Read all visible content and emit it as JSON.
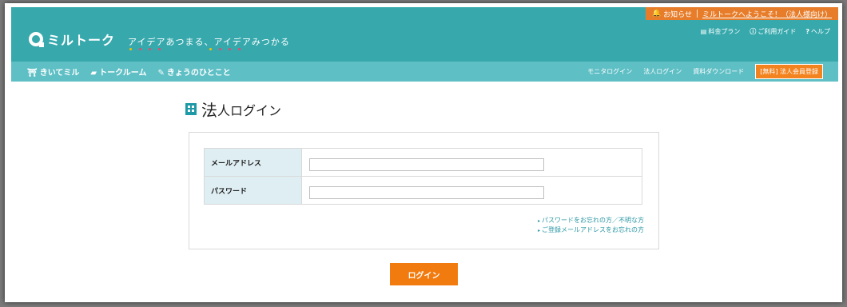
{
  "notice": {
    "icon": "bell-icon",
    "label": "お知らせ",
    "welcome": "ミルトークへようこそ！（法人様向け）"
  },
  "header": {
    "logo_text": "ミルトーク",
    "tagline": "アイデアあつまる、アイデアみつかる",
    "links": [
      {
        "icon": "pricing-icon",
        "label": "料金プラン"
      },
      {
        "icon": "info-icon",
        "label": "ご利用ガイド"
      },
      {
        "icon": "help-icon",
        "label": "ヘルプ"
      }
    ]
  },
  "nav": {
    "left": [
      {
        "icon": "hat-icon",
        "label": "きいてミル"
      },
      {
        "icon": "chat-icon",
        "label": "トークルーム"
      },
      {
        "icon": "megaphone-icon",
        "label": "きょうのひとこと"
      }
    ],
    "right": [
      "モニタログイン",
      "法人ログイン",
      "資料ダウンロード"
    ],
    "register": "[無料] 法人会員登録"
  },
  "page": {
    "title_first": "法",
    "title_rest": "人ログイン"
  },
  "form": {
    "email_label": "メールアドレス",
    "email_value": "",
    "password_label": "パスワード",
    "password_value": ""
  },
  "help_links": [
    "パスワードをお忘れの方／不明な方",
    "ご登録メールアドレスをお忘れの方"
  ],
  "login_button": "ログイン",
  "colors": {
    "teal": "#37a9ad",
    "nav_teal": "#5ebfc5",
    "orange": "#f27b0f",
    "label_bg": "#deeef2"
  }
}
